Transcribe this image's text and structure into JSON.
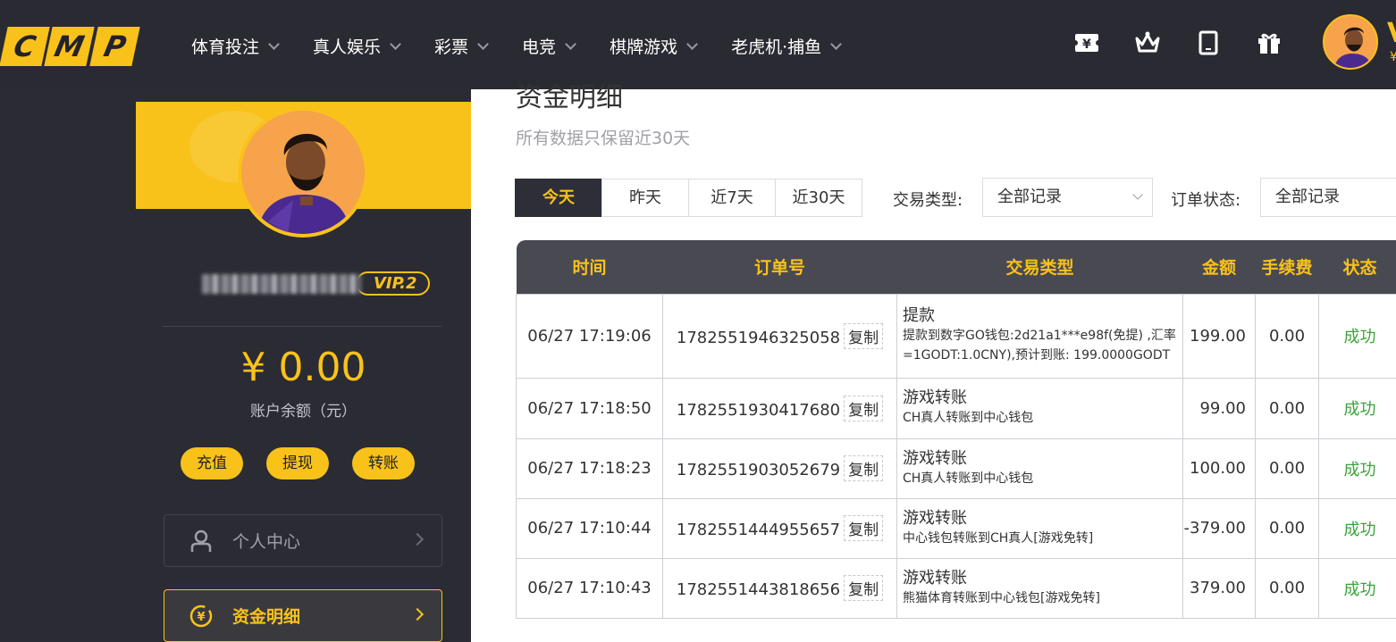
{
  "logo": {
    "letters": [
      "C",
      "M",
      "P"
    ]
  },
  "nav": [
    {
      "label": "体育投注"
    },
    {
      "label": "真人娱乐"
    },
    {
      "label": "彩票"
    },
    {
      "label": "电竞"
    },
    {
      "label": "棋牌游戏"
    },
    {
      "label": "老虎机·捕鱼"
    }
  ],
  "header": {
    "vip_mark": "V",
    "currency_mark": "¥"
  },
  "sidebar": {
    "vip_badge": "VIP.2",
    "balance": "¥ 0.00",
    "balance_label": "账户余额（元）",
    "actions": [
      {
        "label": "充值"
      },
      {
        "label": "提现"
      },
      {
        "label": "转账"
      }
    ],
    "menu": [
      {
        "label": "个人中心"
      },
      {
        "label": "资金明细"
      }
    ]
  },
  "main": {
    "title": "资金明细",
    "subtitle": "所有数据只保留近30天",
    "date_tabs": [
      {
        "label": "今天"
      },
      {
        "label": "昨天"
      },
      {
        "label": "近7天"
      },
      {
        "label": "近30天"
      }
    ],
    "filters": {
      "type_label": "交易类型:",
      "type_value": "全部记录",
      "status_label": "订单状态:",
      "status_value": "全部记录"
    },
    "table": {
      "headers": [
        "时间",
        "订单号",
        "交易类型",
        "金额",
        "手续费",
        "状态"
      ],
      "copy_label": "复制",
      "rows": [
        {
          "time": "06/27 17:19:06",
          "order": "1782551946325058",
          "type": "提款",
          "detail": "提款到数字GO钱包:2d21a1***e98f(免提) ,汇率=1GODT:1.0CNY),预计到账: 199.0000GODT",
          "amount": "199.00",
          "fee": "0.00",
          "status": "成功"
        },
        {
          "time": "06/27 17:18:50",
          "order": "1782551930417680",
          "type": "游戏转账",
          "detail": "CH真人转账到中心钱包",
          "amount": "99.00",
          "fee": "0.00",
          "status": "成功"
        },
        {
          "time": "06/27 17:18:23",
          "order": "1782551903052679",
          "type": "游戏转账",
          "detail": "CH真人转账到中心钱包",
          "amount": "100.00",
          "fee": "0.00",
          "status": "成功"
        },
        {
          "time": "06/27 17:10:44",
          "order": "1782551444955657",
          "type": "游戏转账",
          "detail": "中心钱包转账到CH真人[游戏免转]",
          "amount": "-379.00",
          "fee": "0.00",
          "status": "成功"
        },
        {
          "time": "06/27 17:10:43",
          "order": "1782551443818656",
          "type": "游戏转账",
          "detail": "熊猫体育转账到中心钱包[游戏免转]",
          "amount": "379.00",
          "fee": "0.00",
          "status": "成功"
        }
      ]
    }
  },
  "icons": [
    "yen-ticket-icon",
    "crown-icon",
    "tablet-icon",
    "gift-icon",
    "user-icon",
    "yen-coin-icon"
  ],
  "colors": {
    "accent": "#f9c21a",
    "nav_bg": "#2a2a32",
    "success": "#3aa43a"
  }
}
